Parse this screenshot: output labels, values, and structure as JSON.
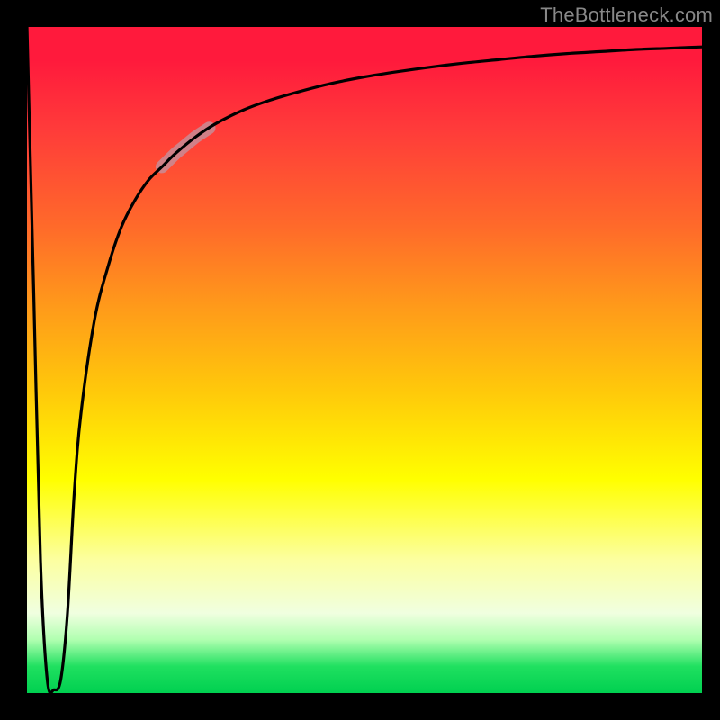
{
  "watermark": "TheBottleneck.com",
  "chart_data": {
    "type": "line",
    "title": "",
    "xlabel": "",
    "ylabel": "",
    "ylim": [
      0,
      100
    ],
    "xlim": [
      0,
      100
    ],
    "x": [
      0,
      1,
      2,
      3,
      4,
      5,
      6,
      7,
      8,
      10,
      12,
      14,
      16,
      18,
      20,
      22,
      25,
      28,
      32,
      36,
      40,
      45,
      50,
      55,
      60,
      65,
      70,
      75,
      80,
      85,
      90,
      95,
      100
    ],
    "values": [
      100,
      60,
      20,
      2,
      0.5,
      2,
      12,
      30,
      42,
      56,
      64,
      70,
      74,
      77,
      79,
      81,
      83.5,
      85.5,
      87.5,
      89,
      90.2,
      91.5,
      92.5,
      93.3,
      94,
      94.6,
      95.1,
      95.6,
      96,
      96.3,
      96.6,
      96.8,
      97
    ],
    "highlight_region": {
      "x_start": 20,
      "x_end": 27,
      "style": "soft-pink-band"
    }
  }
}
